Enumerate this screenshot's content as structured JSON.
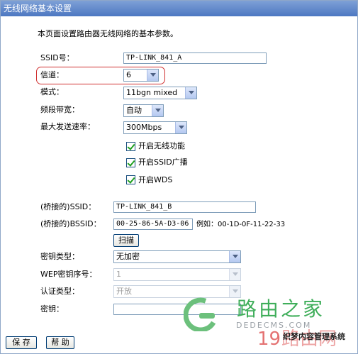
{
  "title": "无线网络基本设置",
  "intro": "本页面设置路由器无线网络的基本参数。",
  "ssid": {
    "label": "SSID号：",
    "value": "TP-LINK_841_A"
  },
  "channel": {
    "label": "信道：",
    "value": "6"
  },
  "mode": {
    "label": "模式：",
    "value": "11bgn mixed"
  },
  "bandwidth": {
    "label": "频段带宽：",
    "value": "自动"
  },
  "max_rate": {
    "label": "最大发送速率：",
    "value": "300Mbps"
  },
  "checkboxes": [
    {
      "label": "开启无线功能",
      "checked": true
    },
    {
      "label": "开启SSID广播",
      "checked": true
    },
    {
      "label": "开启WDS",
      "checked": true
    }
  ],
  "bridge_ssid": {
    "label": "(桥接的)SSID：",
    "value": "TP-LINK_841_B"
  },
  "bridge_bssid": {
    "label": "(桥接的)BSSID：",
    "value": "00-25-86-5A-D3-06",
    "example": "例如：00-1D-0F-11-22-33"
  },
  "scan_label": "扫描",
  "key_type": {
    "label": "密钥类型：",
    "value": "无加密"
  },
  "wep_index": {
    "label": "WEP密钥序号：",
    "value": "1"
  },
  "auth_type": {
    "label": "认证类型：",
    "value": "开放"
  },
  "key": {
    "label": "密钥：",
    "value": ""
  },
  "save_label": "保 存",
  "help_label": "帮 助",
  "watermark": {
    "brand": "路由之家",
    "url": "DEDECMS.COM",
    "num": "19",
    "num2": "路由网",
    "cms": "织梦内容管理系统"
  },
  "colors": {
    "title_bar": "#5b84c8",
    "highlight": "#d03030",
    "watermark_green": "#3fae5a"
  }
}
